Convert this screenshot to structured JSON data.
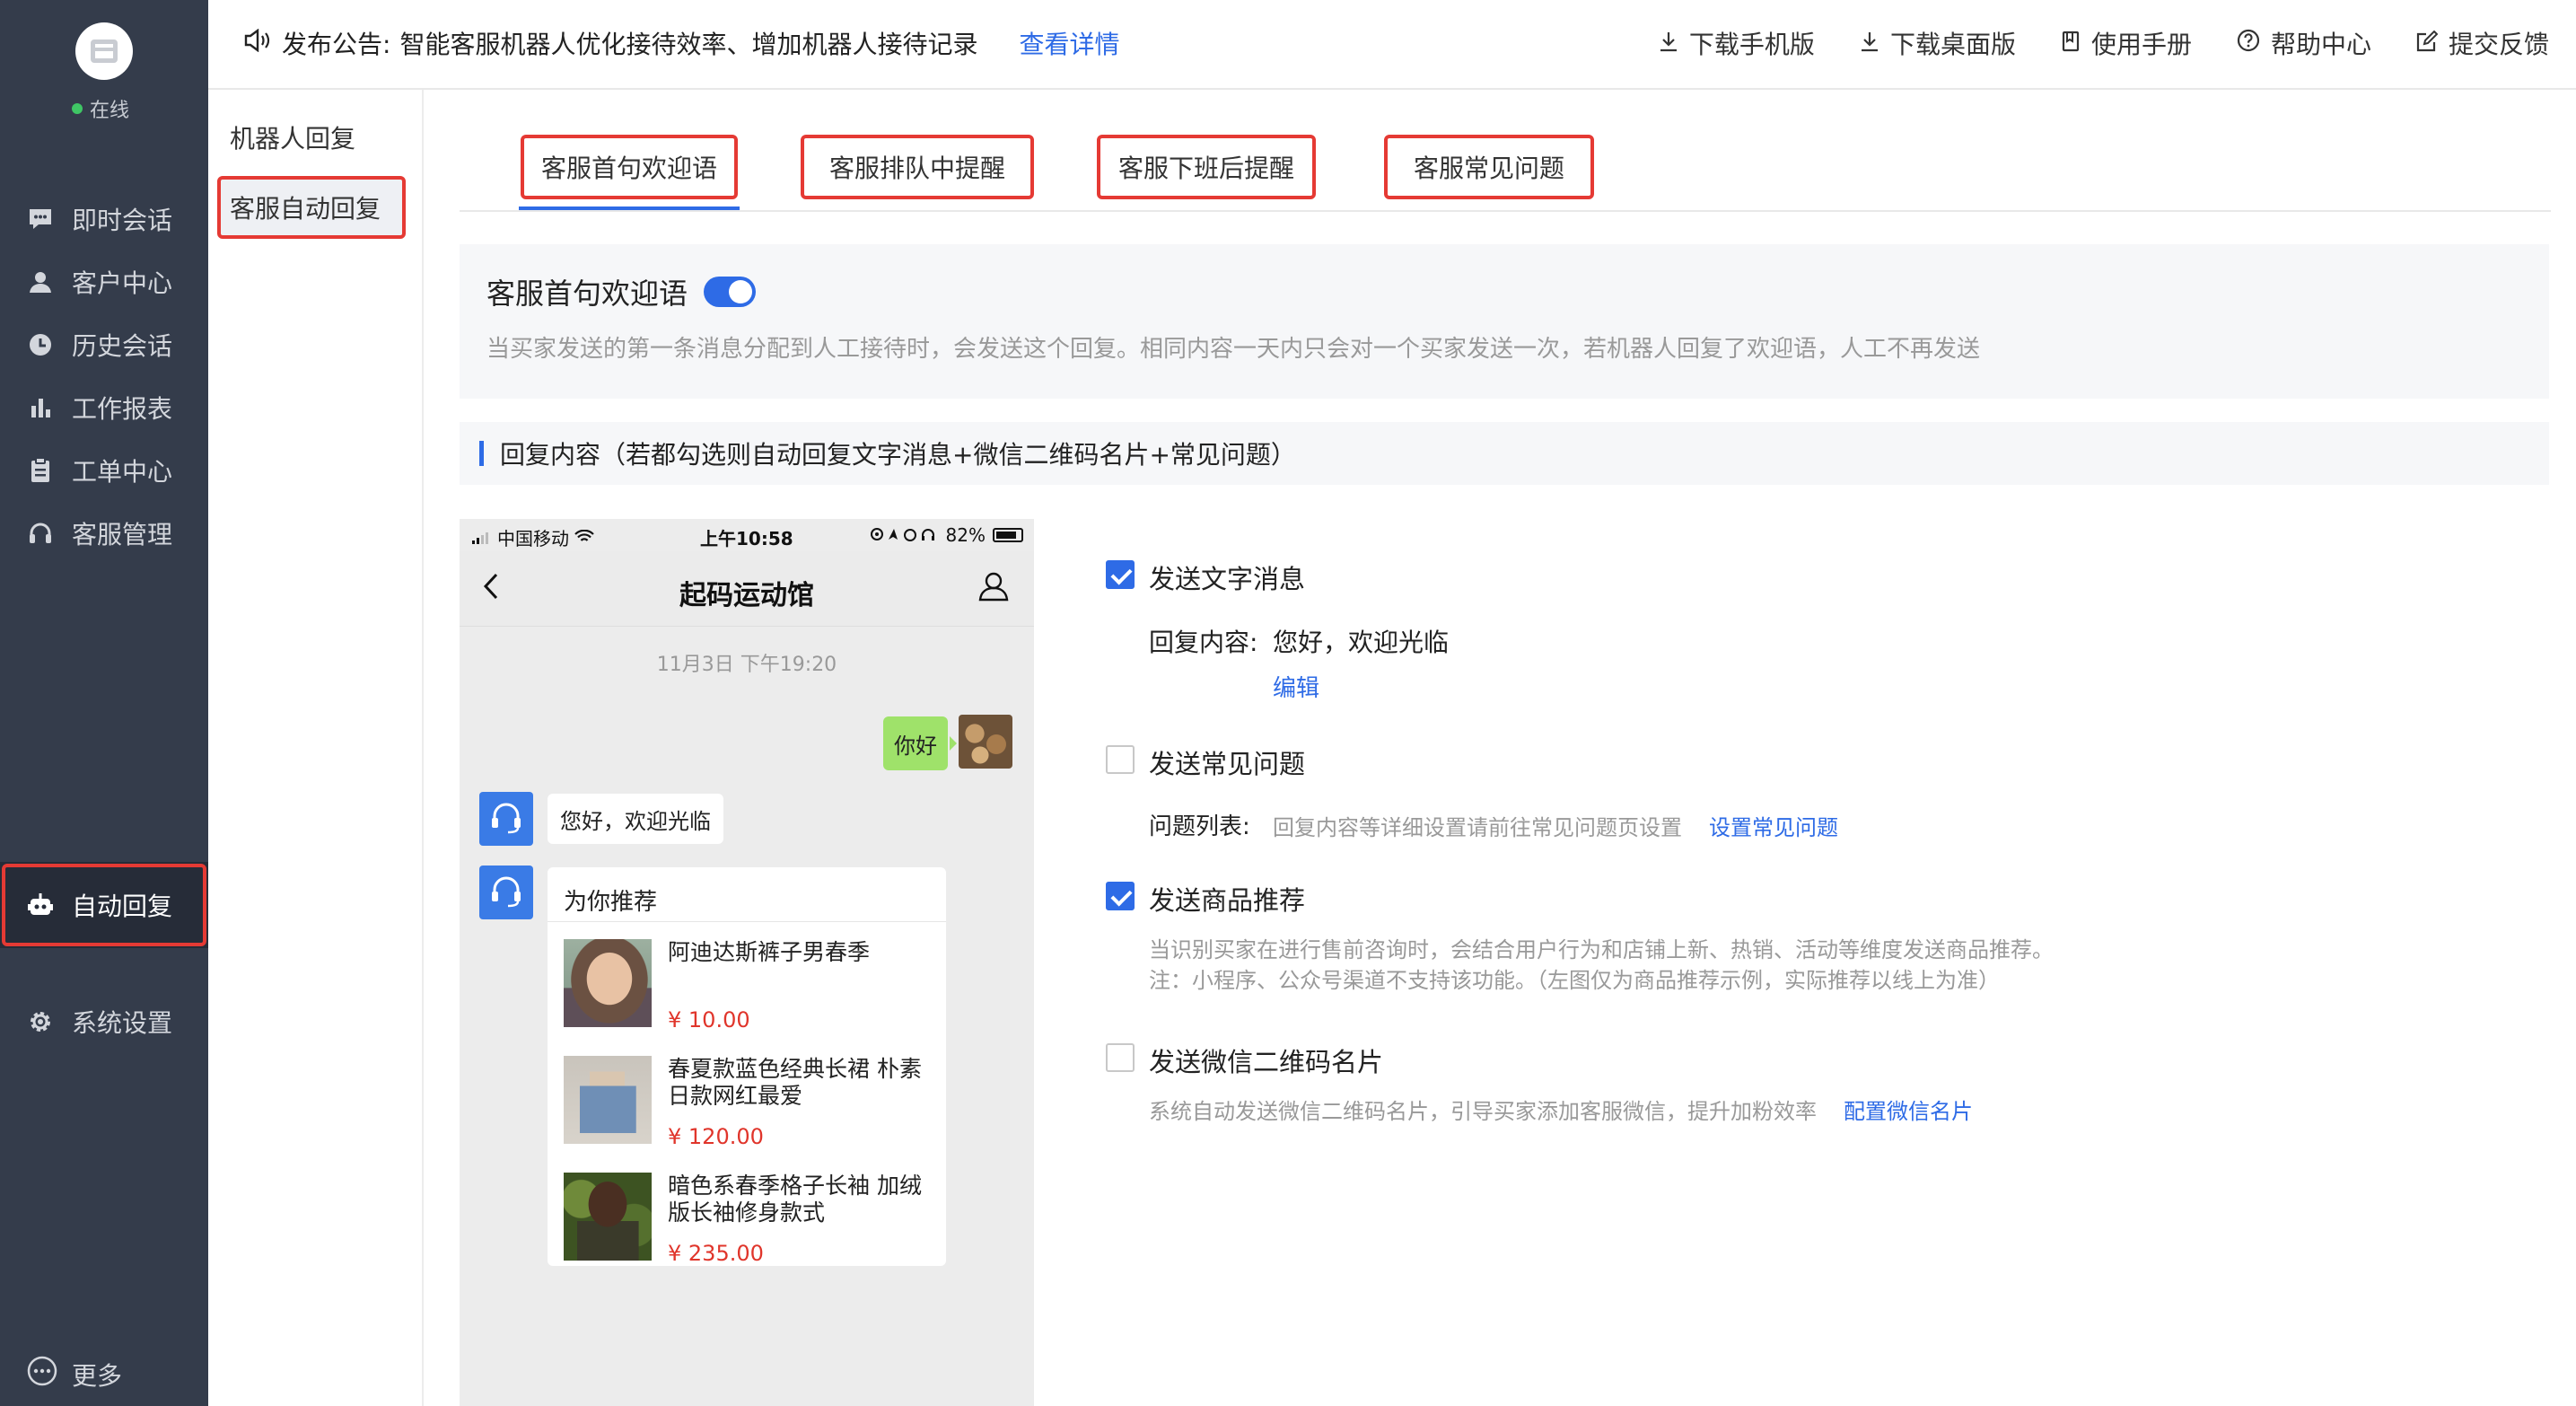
{
  "sidebar": {
    "status": "在线",
    "items": [
      {
        "label": "即时会话",
        "icon": "chat-icon"
      },
      {
        "label": "客户中心",
        "icon": "user-icon"
      },
      {
        "label": "历史会话",
        "icon": "clock-icon"
      },
      {
        "label": "工作报表",
        "icon": "bar-chart-icon"
      },
      {
        "label": "工单中心",
        "icon": "clipboard-icon"
      },
      {
        "label": "客服管理",
        "icon": "headset-icon"
      },
      {
        "label": "自动回复",
        "icon": "robot-icon"
      },
      {
        "label": "系统设置",
        "icon": "gear-icon"
      }
    ],
    "active_item": "自动回复",
    "more": "更多"
  },
  "topbar": {
    "announcement_prefix": "发布公告:",
    "announcement": "智能客服机器人优化接待效率、增加机器人接待记录",
    "announcement_link": "查看详情",
    "links": [
      {
        "label": "下载手机版",
        "icon": "download-icon"
      },
      {
        "label": "下载桌面版",
        "icon": "download-icon"
      },
      {
        "label": "使用手册",
        "icon": "book-icon"
      },
      {
        "label": "帮助中心",
        "icon": "help-circle-icon"
      },
      {
        "label": "提交反馈",
        "icon": "edit-icon"
      }
    ]
  },
  "submenu": {
    "items": [
      "机器人回复",
      "客服自动回复"
    ],
    "active": "客服自动回复"
  },
  "tabs": {
    "items": [
      "客服首句欢迎语",
      "客服排队中提醒",
      "客服下班后提醒",
      "客服常见问题"
    ],
    "active": "客服首句欢迎语"
  },
  "welcome": {
    "title": "客服首句欢迎语",
    "enabled": true,
    "description": "当买家发送的第一条消息分配到人工接待时，会发送这个回复。相同内容一天内只会对一个买家发送一次，若机器人回复了欢迎语，人工不再发送"
  },
  "section": {
    "title": "回复内容（若都勾选则自动回复文字消息+微信二维码名片+常见问题）"
  },
  "phone": {
    "carrier": "中国移动",
    "time": "上午10:58",
    "battery": "82%",
    "title": "起码运动馆",
    "chat_time": "11月3日 下午19:20",
    "outgoing": "你好",
    "incoming": "您好，欢迎光临",
    "recommend_title": "为你推荐",
    "products": [
      {
        "name": "阿迪达斯裤子男春季",
        "price": "¥ 10.00"
      },
      {
        "name": "春夏款蓝色经典长裙 朴素日款网红最爱",
        "price": "¥ 120.00"
      },
      {
        "name": "暗色系春季格子长袖 加绒版长袖修身款式",
        "price": "¥ 235.00"
      }
    ]
  },
  "options": {
    "text_message": {
      "label": "发送文字消息",
      "checked": true,
      "content_label": "回复内容:",
      "content": "您好，欢迎光临",
      "edit": "编辑"
    },
    "faq": {
      "label": "发送常见问题",
      "checked": false,
      "list_label": "问题列表:",
      "hint": "回复内容等详细设置请前往常见问题页设置",
      "link": "设置常见问题"
    },
    "products": {
      "label": "发送商品推荐",
      "checked": true,
      "desc1": "当识别买家在进行售前咨询时，会结合用户行为和店铺上新、热销、活动等维度发送商品推荐。",
      "desc2": "注：小程序、公众号渠道不支持该功能。（左图仅为商品推荐示例，实际推荐以线上为准）"
    },
    "wechat": {
      "label": "发送微信二维码名片",
      "checked": false,
      "desc": "系统自动发送微信二维码名片，引导买家添加客服微信，提升加粉效率",
      "link": "配置微信名片"
    }
  },
  "colors": {
    "sidebar_bg": "#343c4b",
    "accent": "#2e6be6",
    "highlight": "#e53a34",
    "price": "#e0352b",
    "online": "#3fc665"
  }
}
